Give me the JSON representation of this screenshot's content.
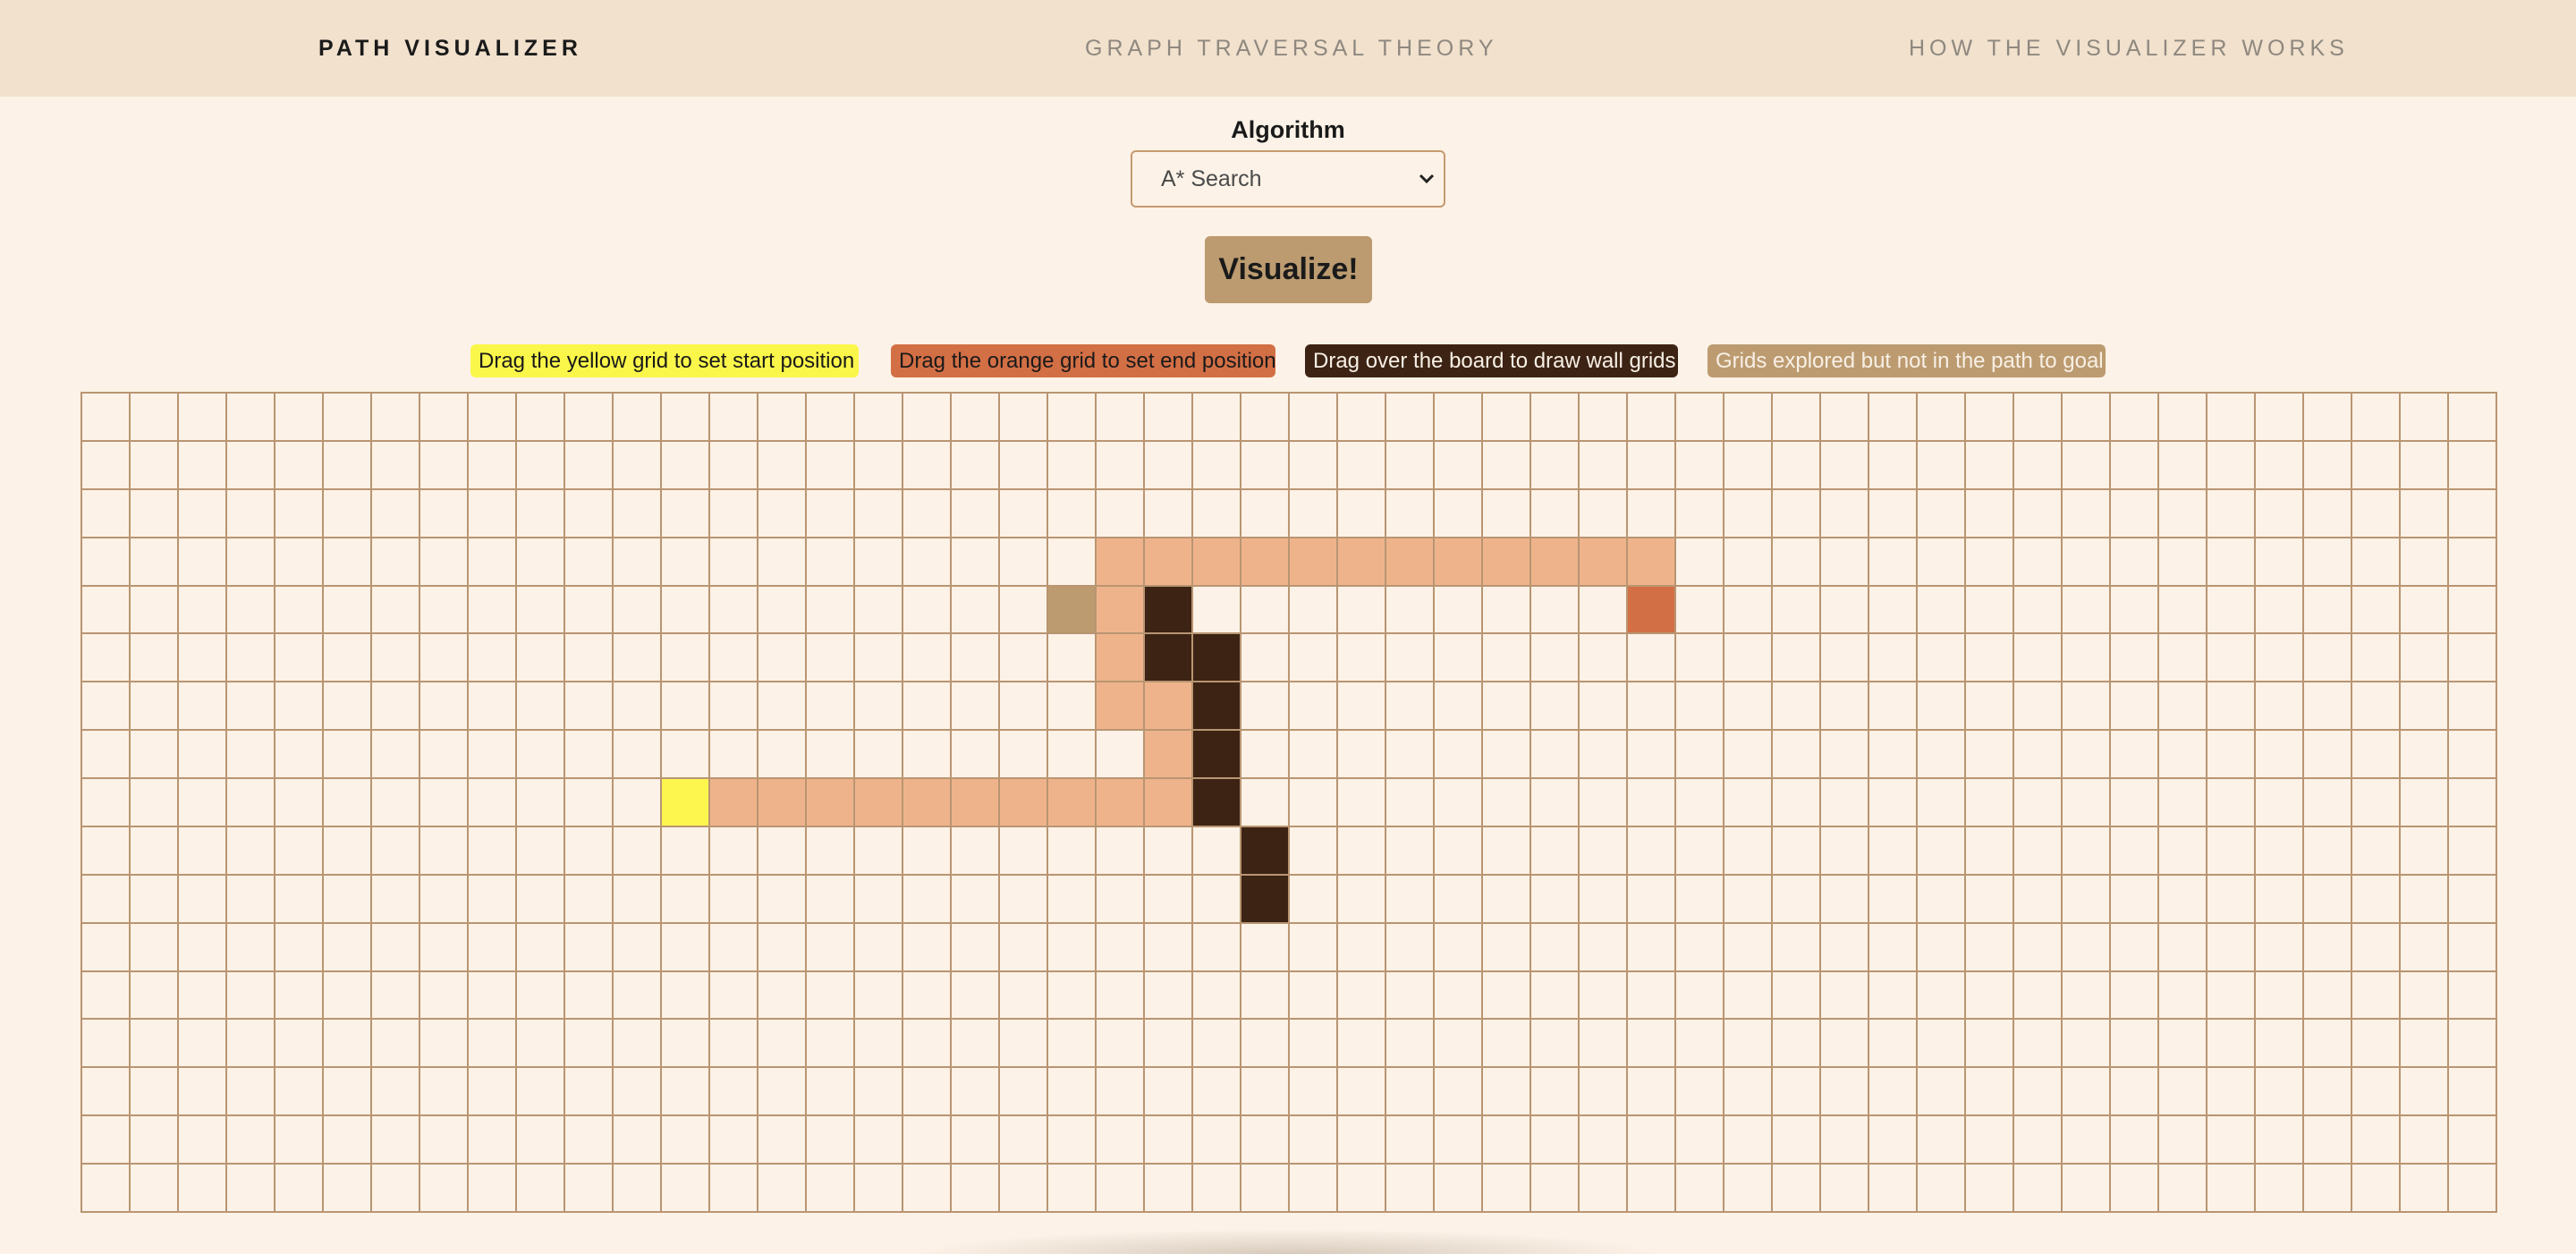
{
  "nav": {
    "brand": "PATH VISUALIZER",
    "theory": "GRAPH TRAVERSAL THEORY",
    "how": "HOW THE VISUALIZER WORKS"
  },
  "controls": {
    "algorithm_label": "Algorithm",
    "algorithm_selected": "A* Search",
    "visualize_label": "Visualize!"
  },
  "legend": {
    "start": "Drag the yellow grid to set start position",
    "end": "Drag the orange grid to set end position",
    "wall": "Drag over the board to draw wall grids",
    "explored": "Grids explored but not in the path to goal"
  },
  "colors": {
    "background": "#fcf2e7",
    "navbar": "#f1e1cd",
    "grid_line": "#b99572",
    "start": "#fcf64e",
    "end": "#d36f45",
    "wall": "#3c2314",
    "path": "#efb38c",
    "explored": "#bc9b70"
  },
  "grid": {
    "cols": 50,
    "rows": 17,
    "start": [
      8,
      12
    ],
    "end": [
      4,
      32
    ],
    "walls": [
      [
        4,
        22
      ],
      [
        5,
        22
      ],
      [
        5,
        23
      ],
      [
        6,
        23
      ],
      [
        7,
        23
      ],
      [
        8,
        23
      ],
      [
        9,
        24
      ],
      [
        10,
        24
      ]
    ],
    "explored": [
      [
        4,
        20
      ]
    ],
    "path": [
      [
        8,
        13
      ],
      [
        8,
        14
      ],
      [
        8,
        15
      ],
      [
        8,
        16
      ],
      [
        8,
        17
      ],
      [
        8,
        18
      ],
      [
        8,
        19
      ],
      [
        8,
        20
      ],
      [
        8,
        21
      ],
      [
        8,
        22
      ],
      [
        7,
        22
      ],
      [
        6,
        22
      ],
      [
        6,
        21
      ],
      [
        5,
        21
      ],
      [
        4,
        21
      ],
      [
        3,
        21
      ],
      [
        3,
        22
      ],
      [
        3,
        23
      ],
      [
        3,
        24
      ],
      [
        3,
        25
      ],
      [
        3,
        26
      ],
      [
        3,
        27
      ],
      [
        3,
        28
      ],
      [
        3,
        29
      ],
      [
        3,
        30
      ],
      [
        3,
        31
      ],
      [
        3,
        32
      ]
    ]
  }
}
